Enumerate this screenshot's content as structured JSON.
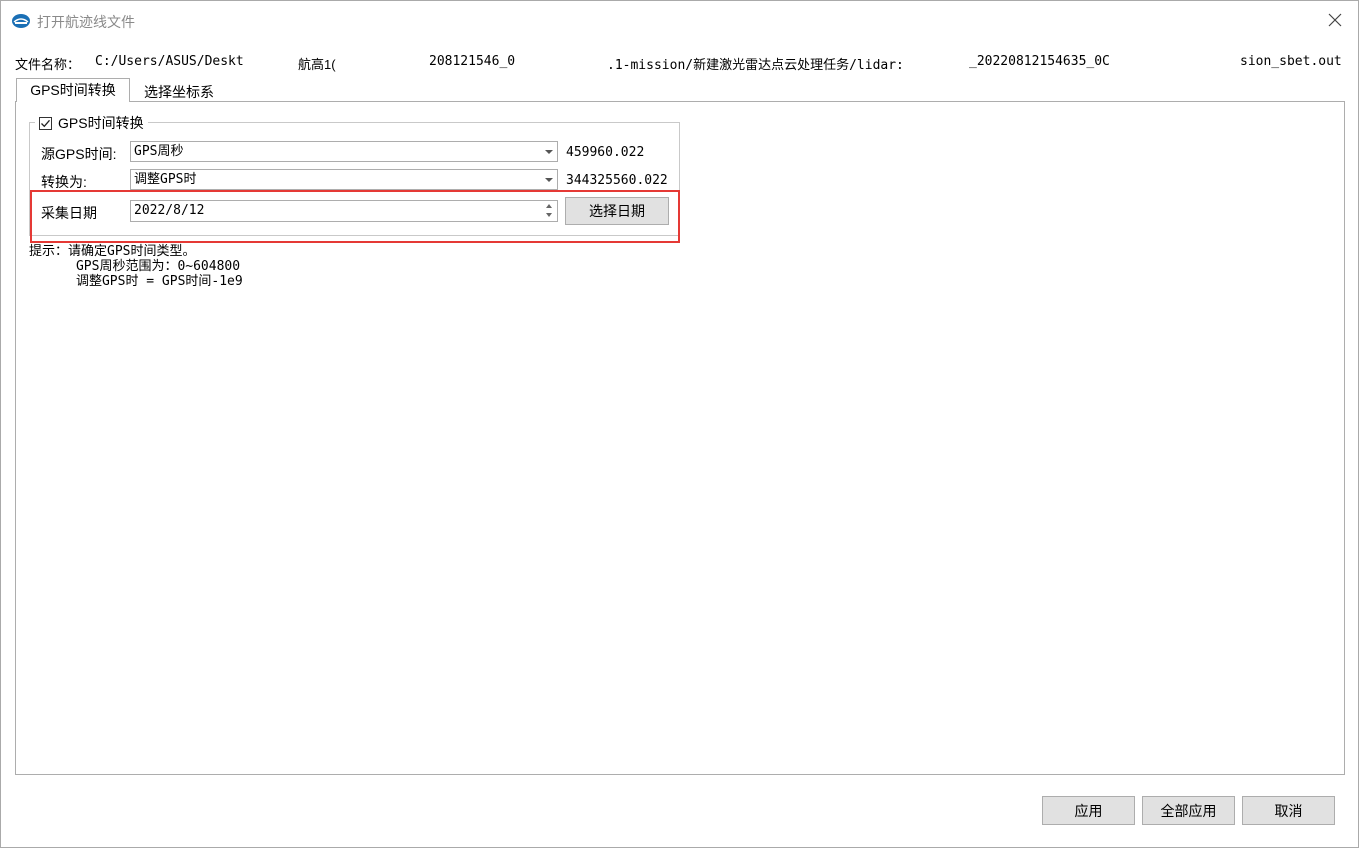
{
  "window": {
    "title": "打开航迹线文件",
    "close_glyph": "✕"
  },
  "file": {
    "label": "文件名称：",
    "segments": [
      "C:/Users/ASUS/Deskt",
      "航高1(",
      "208121546_0",
      ".1-mission/新建激光雷达点云处理任务/lidar:",
      "_20220812154635_0C",
      "sion_sbet.out"
    ]
  },
  "tabs": [
    {
      "label": "GPS时间转换",
      "active": true
    },
    {
      "label": "选择坐标系",
      "active": false
    }
  ],
  "gps_group": {
    "title": "GPS时间转换",
    "checked": true,
    "source_label": "源GPS时间:",
    "source_value": "GPS周秒",
    "source_result": "459960.022",
    "convert_label": "转换为:",
    "convert_value": "调整GPS时",
    "convert_result": "344325560.022",
    "date_label": "采集日期",
    "date_value": "2022/8/12",
    "select_date_button": "选择日期"
  },
  "hint": {
    "line1": "提示：请确定GPS时间类型。",
    "line2": "      GPS周秒范围为：0~604800",
    "line3": "      调整GPS时 = GPS时间-1e9"
  },
  "footer": {
    "apply": "应用",
    "apply_all": "全部应用",
    "cancel": "取消"
  },
  "colors": {
    "highlight_border": "#e53935",
    "button_bg": "#e1e1e1",
    "border": "#adadad"
  }
}
